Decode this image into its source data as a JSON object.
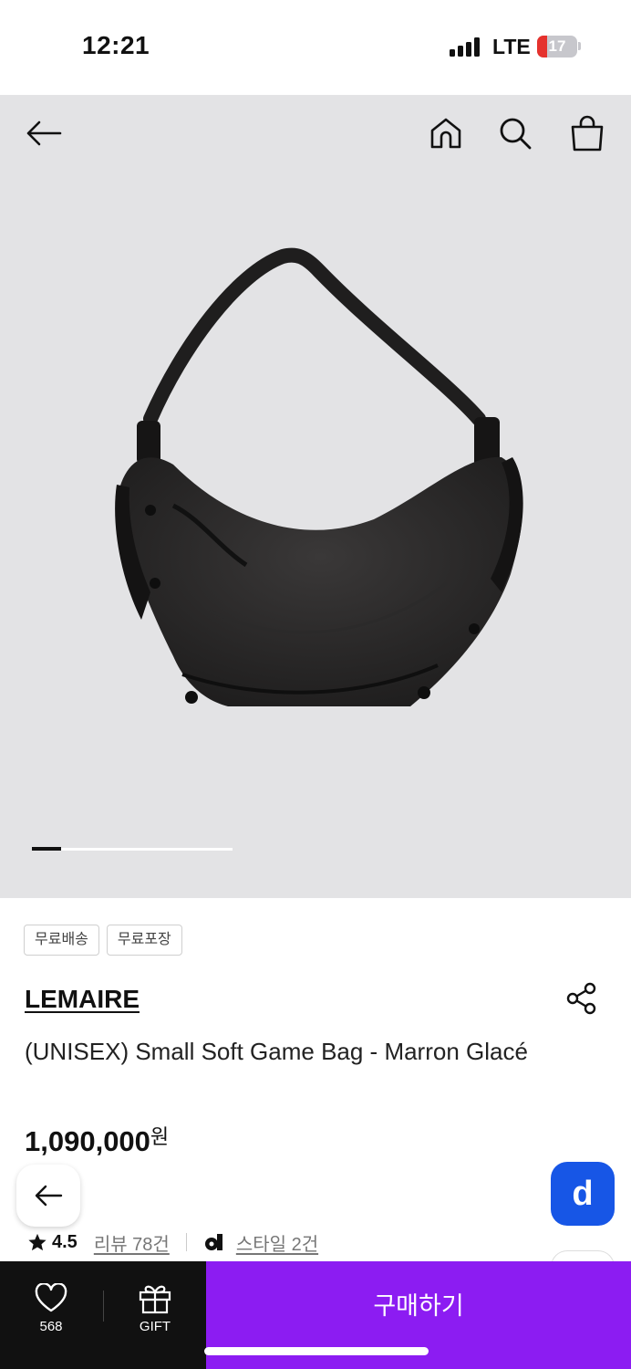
{
  "status_bar": {
    "time": "12:21",
    "network": "LTE",
    "battery_level": "17",
    "battery_color": "#e5322d"
  },
  "top_nav": {
    "back_icon": "arrow-left-icon",
    "home_icon": "home-icon",
    "search_icon": "search-icon",
    "cart_icon": "shopping-bag-icon"
  },
  "gallery": {
    "current_index": 1,
    "background": "#e3e3e5"
  },
  "product": {
    "tags": [
      "무료배송",
      "무료포장"
    ],
    "brand": "LEMAIRE",
    "name": "(UNISEX) Small Soft Game Bag - Marron Glacé",
    "price": "1,090,000",
    "currency": "원",
    "rating": "4.5",
    "review_link": "리뷰 78건",
    "style_link": "스타일 2건"
  },
  "floating": {
    "back_icon": "arrow-left-icon",
    "d_button_label": "d",
    "d_button_color": "#1756e6"
  },
  "bottom_bar": {
    "wish_count": "568",
    "gift_label": "GIFT",
    "buy_label": "구매하기",
    "buy_color": "#8c1cf2"
  }
}
